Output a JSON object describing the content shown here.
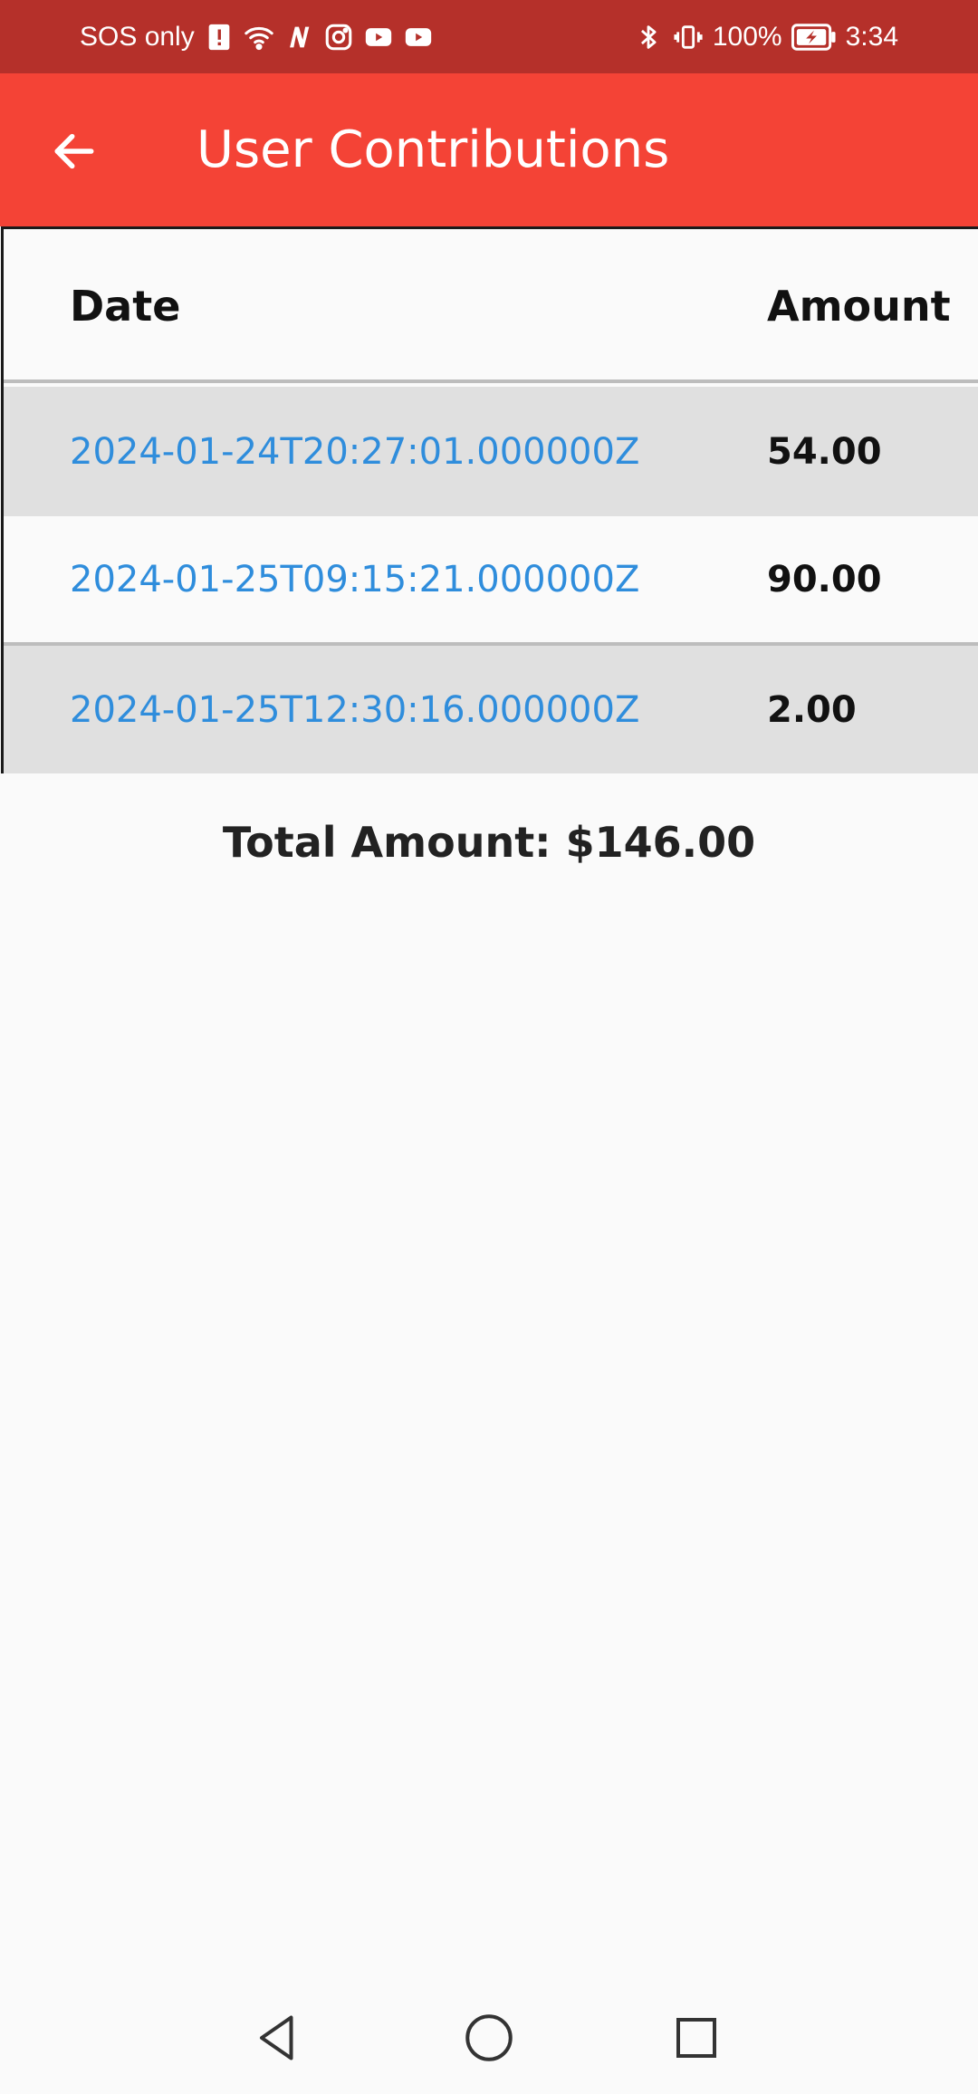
{
  "status_bar": {
    "carrier": "SOS only",
    "battery": "100%",
    "time": "3:34",
    "icons_left": [
      "alert-icon",
      "wifi-icon",
      "nfc-icon",
      "instagram-icon",
      "youtube-icon",
      "youtube-icon"
    ],
    "icons_right": [
      "bluetooth-icon",
      "vibrate-icon",
      "battery-charging-icon"
    ]
  },
  "app_bar": {
    "title": "User Contributions",
    "back_icon": "arrow-left-icon",
    "color": "#f44336"
  },
  "table": {
    "headers": {
      "date": "Date",
      "amount": "Amount"
    },
    "rows": [
      {
        "date": "2024-01-24T20:27:01.000000Z",
        "amount": "54.00"
      },
      {
        "date": "2024-01-25T09:15:21.000000Z",
        "amount": "90.00"
      },
      {
        "date": "2024-01-25T12:30:16.000000Z",
        "amount": "2.00"
      }
    ]
  },
  "total": "Total Amount: $146.00",
  "nav_bar": {
    "back": "nav-back-icon",
    "home": "nav-home-icon",
    "recents": "nav-recents-icon"
  },
  "colors": {
    "status_bar": "#b5302a",
    "app_bar": "#f44336",
    "link": "#2f8ddc",
    "row_shade": "#e0e0e0"
  }
}
